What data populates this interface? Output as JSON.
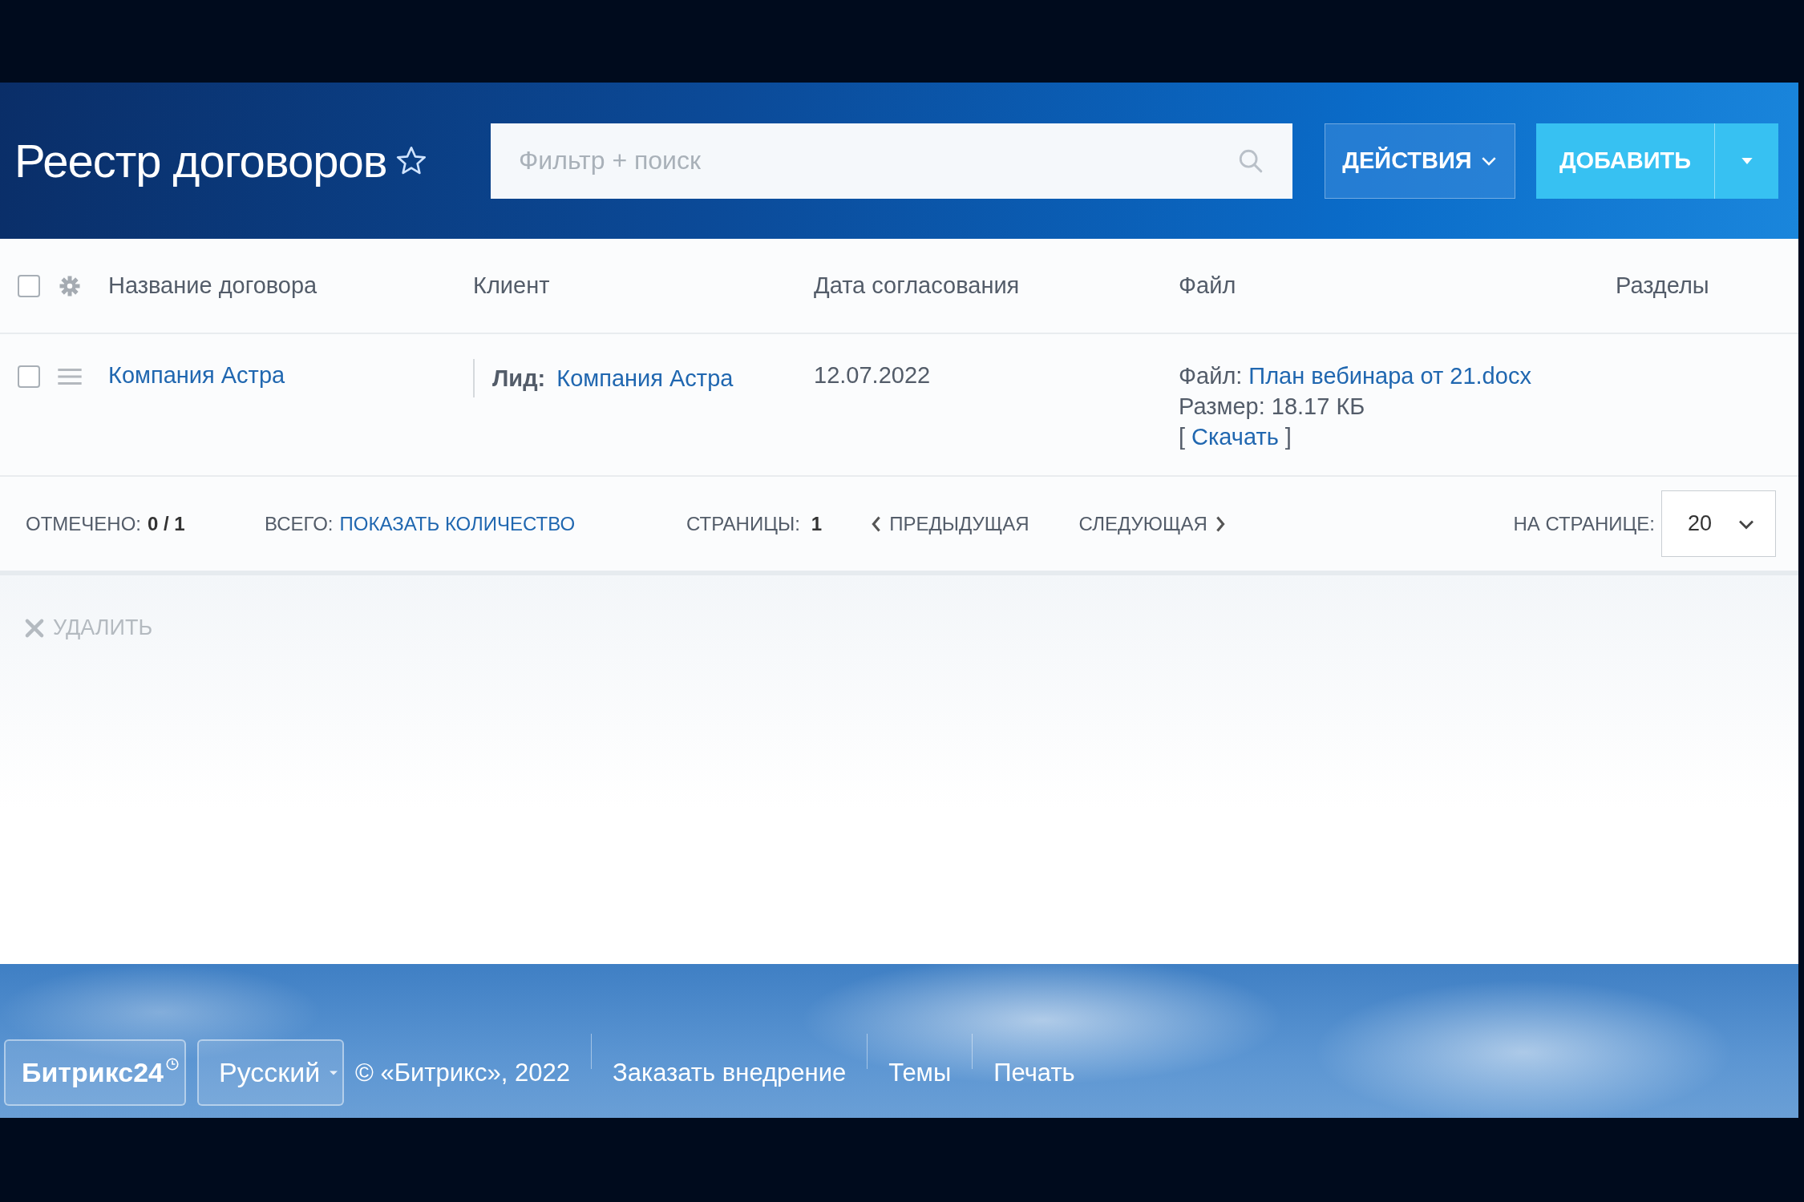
{
  "header": {
    "title": "Реестр договоров",
    "favorite": false,
    "search": {
      "placeholder": "Фильтр + поиск"
    },
    "actions_button": "ДЕЙСТВИЯ",
    "add_button": "ДОБАВИТЬ"
  },
  "table": {
    "all_checked": false,
    "columns": [
      "Название договора",
      "Клиент",
      "Дата согласования",
      "Файл",
      "Разделы"
    ],
    "rows": [
      {
        "checked": false,
        "name": "Компания Астра",
        "client_label": "Лид:",
        "client": "Компания Астра",
        "date": "12.07.2022",
        "file_label": "Файл:",
        "file_name": "План вебинара от 21.docx",
        "file_size": "Размер: 18.17 КБ",
        "download_open": "[",
        "download": "Скачать",
        "download_close": "]"
      }
    ]
  },
  "summary_bar": {
    "selected_label": "ОТМЕЧЕНО:",
    "selected_value": "0 / 1",
    "total_label": "ВСЕГО:",
    "total_link": "ПОКАЗАТЬ КОЛИЧЕСТВО",
    "pages_label": "СТРАНИЦЫ:",
    "current_page": "1",
    "prev": "ПРЕДЫДУЩАЯ",
    "next": "СЛЕДУЮЩАЯ",
    "per_page_label": "НА СТРАНИЦЕ:",
    "per_page": "20"
  },
  "group_actions": [
    {
      "label": "УДАЛИТЬ",
      "disabled": true
    }
  ],
  "footer": {
    "logo": "Битрикс24",
    "language": "Русский",
    "copyright": "© «Битрикс», 2022",
    "links": [
      "Заказать внедрение",
      "Темы",
      "Печать"
    ]
  }
}
